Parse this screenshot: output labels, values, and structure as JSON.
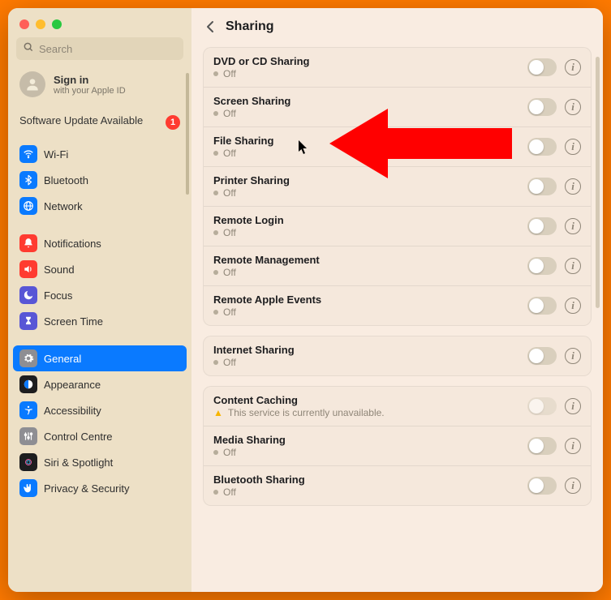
{
  "window": {
    "search_placeholder": "Search",
    "signin_title": "Sign in",
    "signin_sub": "with your Apple ID",
    "update_text": "Software Update Available",
    "update_badge": "1"
  },
  "sidebar": {
    "groups": [
      [
        {
          "id": "wifi",
          "label": "Wi-Fi",
          "bg": "#0a7aff",
          "glyph": "wifi"
        },
        {
          "id": "bluetooth",
          "label": "Bluetooth",
          "bg": "#0a7aff",
          "glyph": "bluetooth"
        },
        {
          "id": "network",
          "label": "Network",
          "bg": "#0a7aff",
          "glyph": "globe"
        }
      ],
      [
        {
          "id": "notifications",
          "label": "Notifications",
          "bg": "#ff3b30",
          "glyph": "bell"
        },
        {
          "id": "sound",
          "label": "Sound",
          "bg": "#ff3b30",
          "glyph": "speaker"
        },
        {
          "id": "focus",
          "label": "Focus",
          "bg": "#5856d6",
          "glyph": "moon"
        },
        {
          "id": "screentime",
          "label": "Screen Time",
          "bg": "#5856d6",
          "glyph": "hourglass"
        }
      ],
      [
        {
          "id": "general",
          "label": "General",
          "bg": "#8e8e93",
          "glyph": "gear",
          "selected": true
        },
        {
          "id": "appearance",
          "label": "Appearance",
          "bg": "#1d1d1f",
          "glyph": "appearance"
        },
        {
          "id": "accessibility",
          "label": "Accessibility",
          "bg": "#0a7aff",
          "glyph": "accessibility"
        },
        {
          "id": "control-centre",
          "label": "Control Centre",
          "bg": "#8e8e93",
          "glyph": "control"
        },
        {
          "id": "siri",
          "label": "Siri & Spotlight",
          "bg": "#1d1d1f",
          "glyph": "siri"
        },
        {
          "id": "privacy",
          "label": "Privacy & Security",
          "bg": "#0a7aff",
          "glyph": "hand"
        }
      ]
    ]
  },
  "header": {
    "title": "Sharing"
  },
  "sections": [
    {
      "rows": [
        {
          "id": "dvd",
          "title": "DVD or CD Sharing",
          "status": "Off",
          "toggle": "off"
        },
        {
          "id": "screen",
          "title": "Screen Sharing",
          "status": "Off",
          "toggle": "off"
        },
        {
          "id": "file",
          "title": "File Sharing",
          "status": "Off",
          "toggle": "off"
        },
        {
          "id": "printer",
          "title": "Printer Sharing",
          "status": "Off",
          "toggle": "off"
        },
        {
          "id": "remote-login",
          "title": "Remote Login",
          "status": "Off",
          "toggle": "off"
        },
        {
          "id": "remote-mgmt",
          "title": "Remote Management",
          "status": "Off",
          "toggle": "off"
        },
        {
          "id": "remote-apple",
          "title": "Remote Apple Events",
          "status": "Off",
          "toggle": "off"
        }
      ]
    },
    {
      "rows": [
        {
          "id": "internet",
          "title": "Internet Sharing",
          "status": "Off",
          "toggle": "off"
        }
      ]
    },
    {
      "rows": [
        {
          "id": "content-caching",
          "title": "Content Caching",
          "status": "This service is currently unavailable.",
          "toggle": "off",
          "warn": true,
          "disabled": true
        },
        {
          "id": "media",
          "title": "Media Sharing",
          "status": "Off",
          "toggle": "off"
        },
        {
          "id": "bluetooth-sharing",
          "title": "Bluetooth Sharing",
          "status": "Off",
          "toggle": "off"
        }
      ]
    }
  ]
}
